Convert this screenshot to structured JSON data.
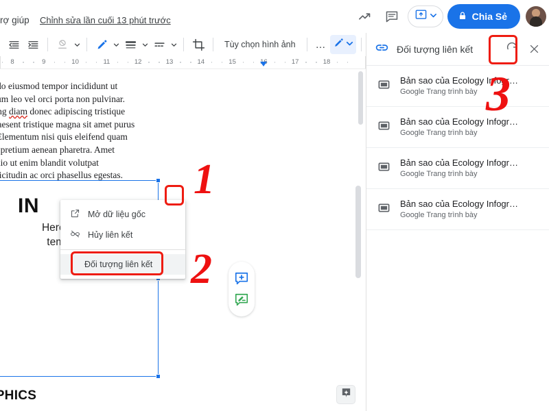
{
  "topbar": {
    "menu_tail": "rợ giúp",
    "last_edit": "Chỉnh sửa lần cuối 13 phút trước",
    "activity_icon": "trending-up-icon",
    "comment_icon": "comment-icon",
    "present_icon": "present-icon",
    "present_caret": "chevron-down-icon",
    "share_label": "Chia Sẻ",
    "share_lock_icon": "lock-icon",
    "avatar": "user-avatar"
  },
  "toolbar": {
    "items": [
      {
        "name": "decrease-indent-icon",
        "label": ""
      },
      {
        "name": "increase-indent-icon",
        "label": ""
      },
      {
        "name": "clear-formatting-icon",
        "label": ""
      },
      {
        "name": "border-color-icon",
        "label": ""
      },
      {
        "name": "border-weight-icon",
        "label": ""
      },
      {
        "name": "border-dash-icon",
        "label": ""
      },
      {
        "name": "crop-icon",
        "label": ""
      }
    ],
    "image_options_label": "Tùy chọn hình ảnh",
    "more_label": "…",
    "edit_mode_icon": "pencil-icon",
    "edit_mode_caret": "chevron-down-icon",
    "collapse_icon": "chevron-up-icon"
  },
  "ruler": {
    "numbers": [
      "8",
      "9",
      "10",
      "11",
      "12",
      "13",
      "14",
      "15",
      "16",
      "17",
      "18"
    ],
    "marker_at": "16"
  },
  "document": {
    "paragraph_lines": [
      "iscing elit, sed do eiusmod tempor incididunt ut",
      "t proin fermentum leo vel orci porta non pulvinar.",
      "im eu. Adipiscing diam donec adipiscing tristique",
      "Aliquet nibh praesent tristique magna sit amet purus",
      "m vestibulum. Elementum nisi quis eleifend quam",
      "u turpis egestas pretium aenean pharetra. Amet",
      "integer quis. Odio ut enim blandit volutpat",
      "rmentum et sollicitudin ac orci phasellus egestas."
    ],
    "misspelled_word": "diam",
    "infographic": {
      "title": "IN",
      "subtitle_line1": "Here is where this",
      "subtitle_line2": "template begins"
    },
    "bottom_heading": "INFOGRAPHICS"
  },
  "link_chip": {
    "link_icon": "broken-link-icon",
    "expand_icon": "chevron-down-icon"
  },
  "context_menu": {
    "items": [
      {
        "label": "Mở dữ liệu gốc",
        "icon": "open-in-new-icon"
      },
      {
        "label": "Hủy liên kết",
        "icon": "unlink-icon"
      },
      {
        "label": "Đối tượng liên kết",
        "icon": ""
      }
    ],
    "highlighted_index": 2
  },
  "comment_rail": {
    "add_comment_icon": "add-comment-icon",
    "suggest_edit_icon": "suggest-edit-icon"
  },
  "bottom_button": {
    "icon": "explore-icon"
  },
  "panel": {
    "link_icon": "link-icon",
    "title": "Đối tượng liên kết",
    "refresh_icon": "refresh-icon",
    "close_icon": "close-icon",
    "items": [
      {
        "name": "Bản sao của Ecology Infographics…",
        "sub": "Google Trang trình bày",
        "icon": "slides-icon"
      },
      {
        "name": "Bản sao của Ecology Infographics…",
        "sub": "Google Trang trình bày",
        "icon": "slides-icon"
      },
      {
        "name": "Bản sao của Ecology Infographics…",
        "sub": "Google Trang trình bày",
        "icon": "slides-icon"
      },
      {
        "name": "Bản sao của Ecology Infographics…",
        "sub": "Google Trang trình bày",
        "icon": "slides-icon"
      }
    ]
  },
  "annotations": {
    "marker_1": "1",
    "marker_2": "2",
    "marker_3": "3",
    "highlight_color": "#ee1c11"
  },
  "colors": {
    "accent_blue": "#1a73e8",
    "annotation_red": "#ee1c11",
    "text_primary": "#202124",
    "text_secondary": "#5f6368"
  }
}
